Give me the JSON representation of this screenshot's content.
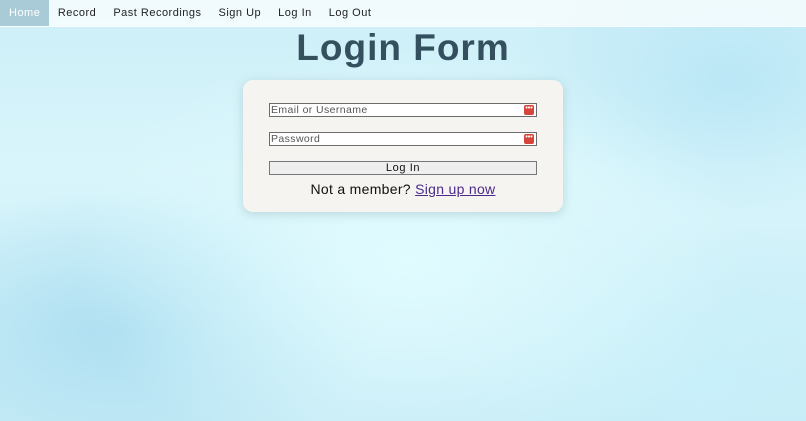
{
  "nav": {
    "items": [
      {
        "label": "Home",
        "active": true
      },
      {
        "label": "Record",
        "active": false
      },
      {
        "label": "Past Recordings",
        "active": false
      },
      {
        "label": "Sign Up",
        "active": false
      },
      {
        "label": "Log In",
        "active": false
      },
      {
        "label": "Log Out",
        "active": false
      }
    ]
  },
  "page": {
    "title": "Login Form"
  },
  "form": {
    "email_placeholder": "Email or Username",
    "email_value": "",
    "password_placeholder": "Password",
    "password_value": "",
    "password_manager_icon": "key-dots-icon",
    "password_manager_glyph": "•••",
    "submit_label": "Log In",
    "signup_prompt": "Not a member?",
    "signup_link": "Sign up now"
  },
  "colors": {
    "nav_active_bg": "#a9cbd8",
    "title": "#34505f",
    "card_bg": "#f6f4f1",
    "link": "#4b2a8a",
    "pw_icon": "#d6453a"
  }
}
